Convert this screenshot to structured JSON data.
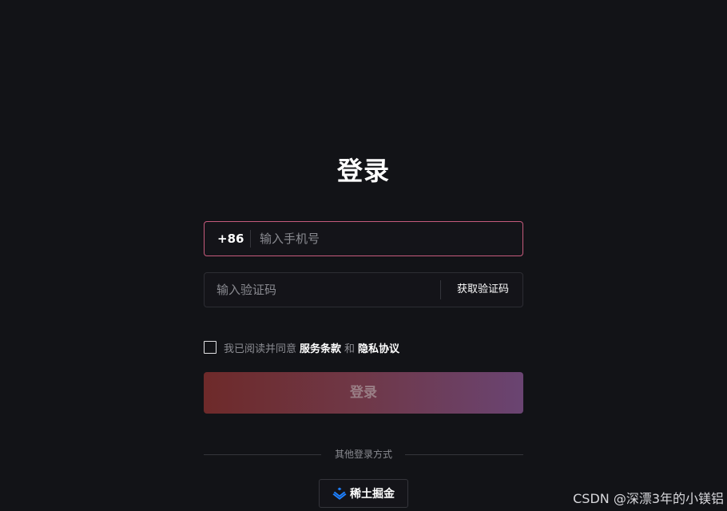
{
  "page": {
    "title": "登录"
  },
  "phone": {
    "country_code": "+86",
    "value": "",
    "placeholder": "输入手机号"
  },
  "verification": {
    "value": "",
    "placeholder": "输入验证码",
    "get_code_label": "获取验证码"
  },
  "agreement": {
    "checked": false,
    "prefix": "我已阅读并同意",
    "terms_label": "服务条款",
    "connector": "和",
    "privacy_label": "隐私协议"
  },
  "login_button": {
    "label": "登录"
  },
  "other_login": {
    "label": "其他登录方式",
    "providers": [
      {
        "name": "稀土掘金",
        "icon": "juejin-icon"
      }
    ]
  },
  "watermark": {
    "text": "CSDN @深漂3年的小镁铝"
  },
  "colors": {
    "background": "#121317",
    "phone_border_focus": "#c65a7c",
    "login_gradient_start": "#6e2a2a",
    "login_gradient_end": "#6a4472",
    "juejin_blue": "#1e80ff"
  }
}
